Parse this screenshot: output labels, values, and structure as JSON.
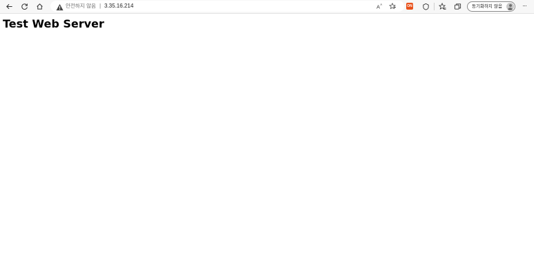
{
  "browser": {
    "nav": {
      "back_icon": "back-arrow-icon",
      "refresh_icon": "refresh-icon",
      "home_icon": "home-icon"
    },
    "address_bar": {
      "security_icon": "warning-triangle-icon",
      "security_text": "안전하지 않음",
      "separator": "|",
      "url": "3.35.16.214",
      "read_aloud_icon": "read-aloud-icon",
      "favorite_icon": "add-favorite-icon"
    },
    "toolbar": {
      "extension_icon": "extension-icon",
      "extension_badge": "ON",
      "browser_essentials_icon": "browser-essentials-icon",
      "favorites_icon": "favorites-icon",
      "collections_icon": "collections-icon",
      "sync_label": "동기화하지 않음",
      "profile_icon": "profile-avatar-icon",
      "menu_icon": "more-menu-icon",
      "menu_glyph": "···"
    }
  },
  "page": {
    "heading": "Test Web Server",
    "background": "#ffffff"
  },
  "colors": {
    "toolbar_bg": "#f7f7f7",
    "warning": "#333333",
    "extension": "#e8521c"
  }
}
